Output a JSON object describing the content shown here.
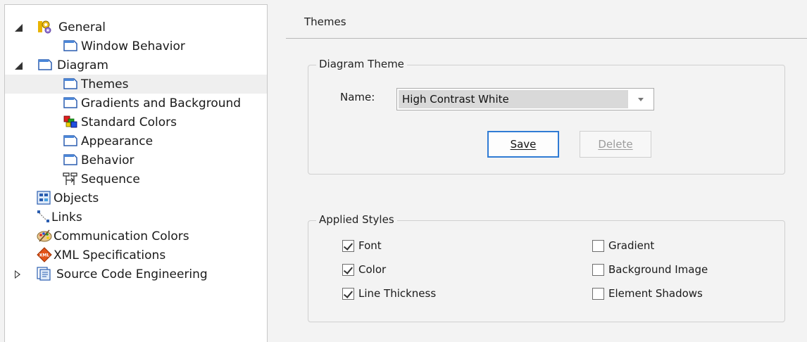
{
  "tree": {
    "items": [
      {
        "label": "General",
        "icon": "general-gears-icon"
      },
      {
        "label": "Window Behavior",
        "icon": "page-icon"
      },
      {
        "label": "Diagram",
        "icon": "page-icon"
      },
      {
        "label": "Themes",
        "icon": "page-icon"
      },
      {
        "label": "Gradients and Background",
        "icon": "page-icon"
      },
      {
        "label": "Standard Colors",
        "icon": "color-squares-icon"
      },
      {
        "label": "Appearance",
        "icon": "page-icon"
      },
      {
        "label": "Behavior",
        "icon": "page-icon"
      },
      {
        "label": "Sequence",
        "icon": "sequence-icon"
      },
      {
        "label": "Objects",
        "icon": "objects-icon"
      },
      {
        "label": "Links",
        "icon": "links-icon"
      },
      {
        "label": "Communication Colors",
        "icon": "palette-icon"
      },
      {
        "label": "XML Specifications",
        "icon": "xml-icon"
      },
      {
        "label": "Source Code Engineering",
        "icon": "source-code-icon"
      }
    ]
  },
  "main": {
    "title": "Themes",
    "diagram_theme": {
      "legend": "Diagram Theme",
      "name_label": "Name:",
      "selected_theme": "High Contrast White",
      "save_label": "Save",
      "delete_label": "Delete"
    },
    "applied_styles": {
      "legend": "Applied Styles",
      "options": [
        {
          "label": "Font",
          "checked": true
        },
        {
          "label": "Color",
          "checked": true
        },
        {
          "label": "Line Thickness",
          "checked": true
        },
        {
          "label": "Gradient",
          "checked": false
        },
        {
          "label": "Background Image",
          "checked": false
        },
        {
          "label": "Element Shadows",
          "checked": false
        }
      ]
    }
  },
  "colors": {
    "accent": "#2f7bd4",
    "selected_row": "#efefef"
  }
}
